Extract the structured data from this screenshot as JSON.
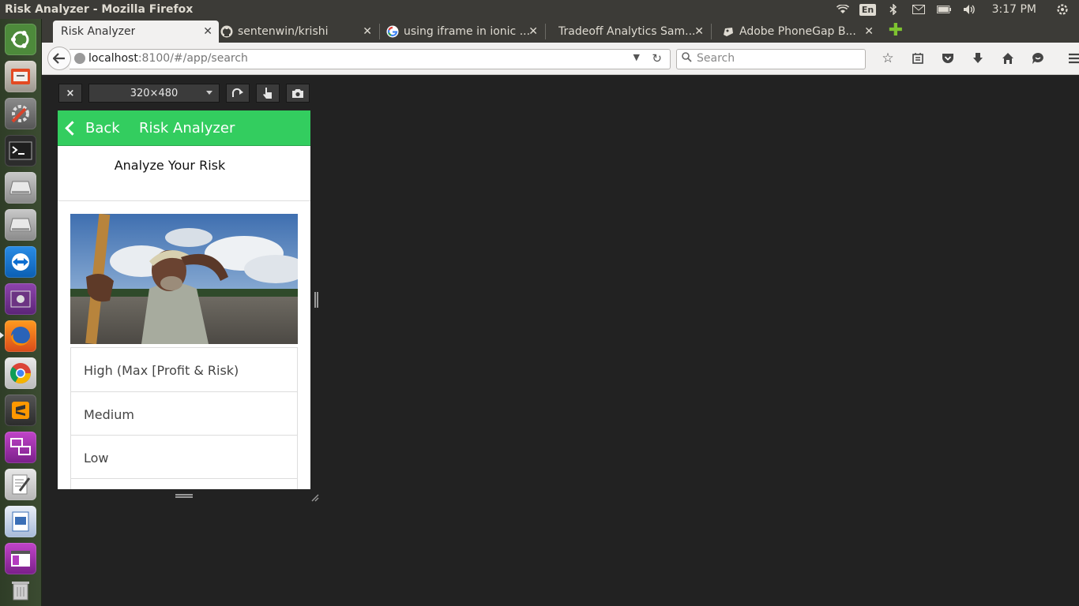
{
  "window": {
    "title": "Risk Analyzer - Mozilla Firefox"
  },
  "system_tray": {
    "keyboard_layout": "En",
    "clock": "3:17 PM"
  },
  "launcher": {
    "apps": [
      {
        "name": "ubuntu-dash"
      },
      {
        "name": "files"
      },
      {
        "name": "system-settings"
      },
      {
        "name": "terminal"
      },
      {
        "name": "drive"
      },
      {
        "name": "drive-2"
      },
      {
        "name": "teamviewer"
      },
      {
        "name": "media-app"
      },
      {
        "name": "firefox"
      },
      {
        "name": "chrome"
      },
      {
        "name": "sublime-text"
      },
      {
        "name": "remote-desktop"
      },
      {
        "name": "text-editor"
      },
      {
        "name": "libreoffice-impress"
      },
      {
        "name": "app-window"
      },
      {
        "name": "trash"
      }
    ]
  },
  "tabs": [
    {
      "label": "Risk Analyzer",
      "active": true
    },
    {
      "label": "sentenwin/krishi",
      "active": false
    },
    {
      "label": "using iframe in ionic ...",
      "active": false
    },
    {
      "label": "Tradeoff Analytics Sam...",
      "active": false
    },
    {
      "label": "Adobe PhoneGap B...",
      "active": false
    }
  ],
  "navbar": {
    "url_host": "localhost",
    "url_rest": ":8100/#/app/search",
    "search_placeholder": "Search"
  },
  "rdm": {
    "close_label": "×",
    "size_label": "320×480"
  },
  "app": {
    "back_label": "Back",
    "header_title": "Risk Analyzer",
    "page_title": "Analyze Your Risk",
    "options": [
      {
        "label": "High (Max [Profit & Risk)"
      },
      {
        "label": "Medium"
      },
      {
        "label": "Low"
      }
    ]
  },
  "colors": {
    "header_green": "#33cd5f",
    "desktop_bg": "#222222"
  }
}
